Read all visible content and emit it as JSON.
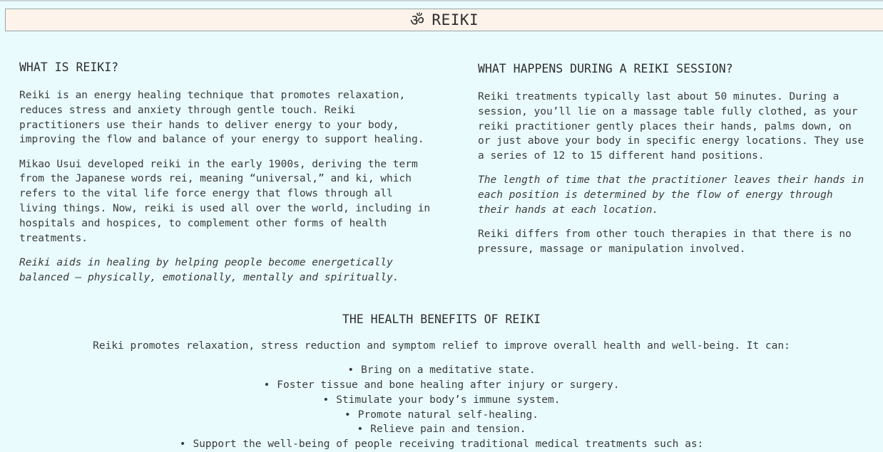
{
  "header": {
    "icon": "om-icon",
    "icon_glyph": "ॐ",
    "title": "REIKI"
  },
  "left": {
    "heading": "WHAT IS REIKI?",
    "p1": "Reiki is an energy healing technique that promotes relaxation, reduces stress and anxiety through gentle touch. Reiki practitioners use their hands to deliver energy to your body, improving the flow and balance of your energy to support healing.",
    "p2": "Mikao Usui developed reiki in the early 1900s, deriving the term from the Japanese words rei, meaning “universal,” and ki, which refers to the vital life force energy that flows through all living things. Now, reiki is used all over the world, including in hospitals and hospices, to complement other forms of health treatments.",
    "p3": "Reiki aids in healing by helping people become energetically balanced — physically, emotionally, mentally and spiritually."
  },
  "right": {
    "heading": "WHAT HAPPENS DURING A REIKI SESSION?",
    "p1": "Reiki treatments typically last about 50 minutes. During a session, you’ll lie on a massage table fully clothed, as your reiki practitioner gently places their hands, palms down, on or just above your body in specific energy locations. They use a series of 12 to 15 different hand positions.",
    "p2": "The length of time that the practitioner leaves their hands in each position is determined by the flow of energy through their hands at each location.",
    "p3": "Reiki differs from other touch therapies in that there is no pressure, massage or manipulation involved."
  },
  "benefits": {
    "heading": "THE HEALTH BENEFITS OF REIKI",
    "intro": "Reiki promotes relaxation, stress reduction and symptom relief to improve overall health and well-being. It can:",
    "items": [
      "Bring on a meditative state.",
      "Foster tissue and bone healing after injury or surgery.",
      "Stimulate your body’s immune system.",
      "Promote natural self-healing.",
      "Relieve pain and tension.",
      "Support the well-being of people receiving traditional medical treatments such as:"
    ]
  }
}
